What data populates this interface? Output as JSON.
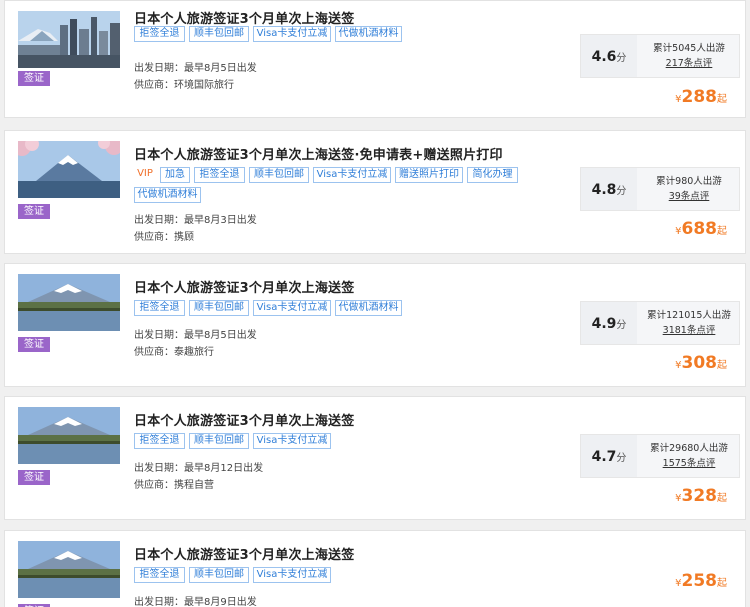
{
  "labels": {
    "category_badge": "签证",
    "score_unit": "分",
    "currency": "¥",
    "price_suffix": "起"
  },
  "listings": [
    {
      "title": "日本个人旅游签证3个月单次上海送签",
      "tags": [
        "拒签全退",
        "顺丰包回邮",
        "Visa卡支付立减",
        "代做机酒材料"
      ],
      "departure": "出发日期：最早8月5日出发",
      "supplier": "供应商：环境国际旅行",
      "score": "4.6",
      "travelers": "累计5045人出游",
      "reviews": "217条点评",
      "price": "288",
      "image": "tokyo-skyline"
    },
    {
      "title": "日本个人旅游签证3个月单次上海送签·免申请表+赠送照片打印",
      "tags": [
        "VIP",
        "加急",
        "拒签全退",
        "顺丰包回邮",
        "Visa卡支付立减",
        "赠送照片打印",
        "简化办理",
        "代做机酒材料"
      ],
      "departure": "出发日期：最早8月3日出发",
      "supplier": "供应商：携顾",
      "score": "4.8",
      "travelers": "累计980人出游",
      "reviews": "39条点评",
      "price": "688",
      "image": "fuji-blossom"
    },
    {
      "title": "日本个人旅游签证3个月单次上海送签",
      "tags": [
        "拒签全退",
        "顺丰包回邮",
        "Visa卡支付立减",
        "代做机酒材料"
      ],
      "departure": "出发日期：最早8月5日出发",
      "supplier": "供应商：泰趣旅行",
      "score": "4.9",
      "travelers": "累计121015人出游",
      "reviews": "3181条点评",
      "price": "308",
      "image": "fuji-lake"
    },
    {
      "title": "日本个人旅游签证3个月单次上海送签",
      "tags": [
        "拒签全退",
        "顺丰包回邮",
        "Visa卡支付立减"
      ],
      "departure": "出发日期：最早8月12日出发",
      "supplier": "供应商：携程自营",
      "score": "4.7",
      "travelers": "累计29680人出游",
      "reviews": "1575条点评",
      "price": "328",
      "image": "fuji-lake"
    },
    {
      "title": "日本个人旅游签证3个月单次上海送签",
      "tags": [
        "拒签全退",
        "顺丰包回邮",
        "Visa卡支付立减"
      ],
      "departure": "出发日期：最早8月9日出发",
      "supplier": "",
      "score": "",
      "travelers": "",
      "reviews": "",
      "price": "258",
      "image": "fuji-lake"
    }
  ]
}
